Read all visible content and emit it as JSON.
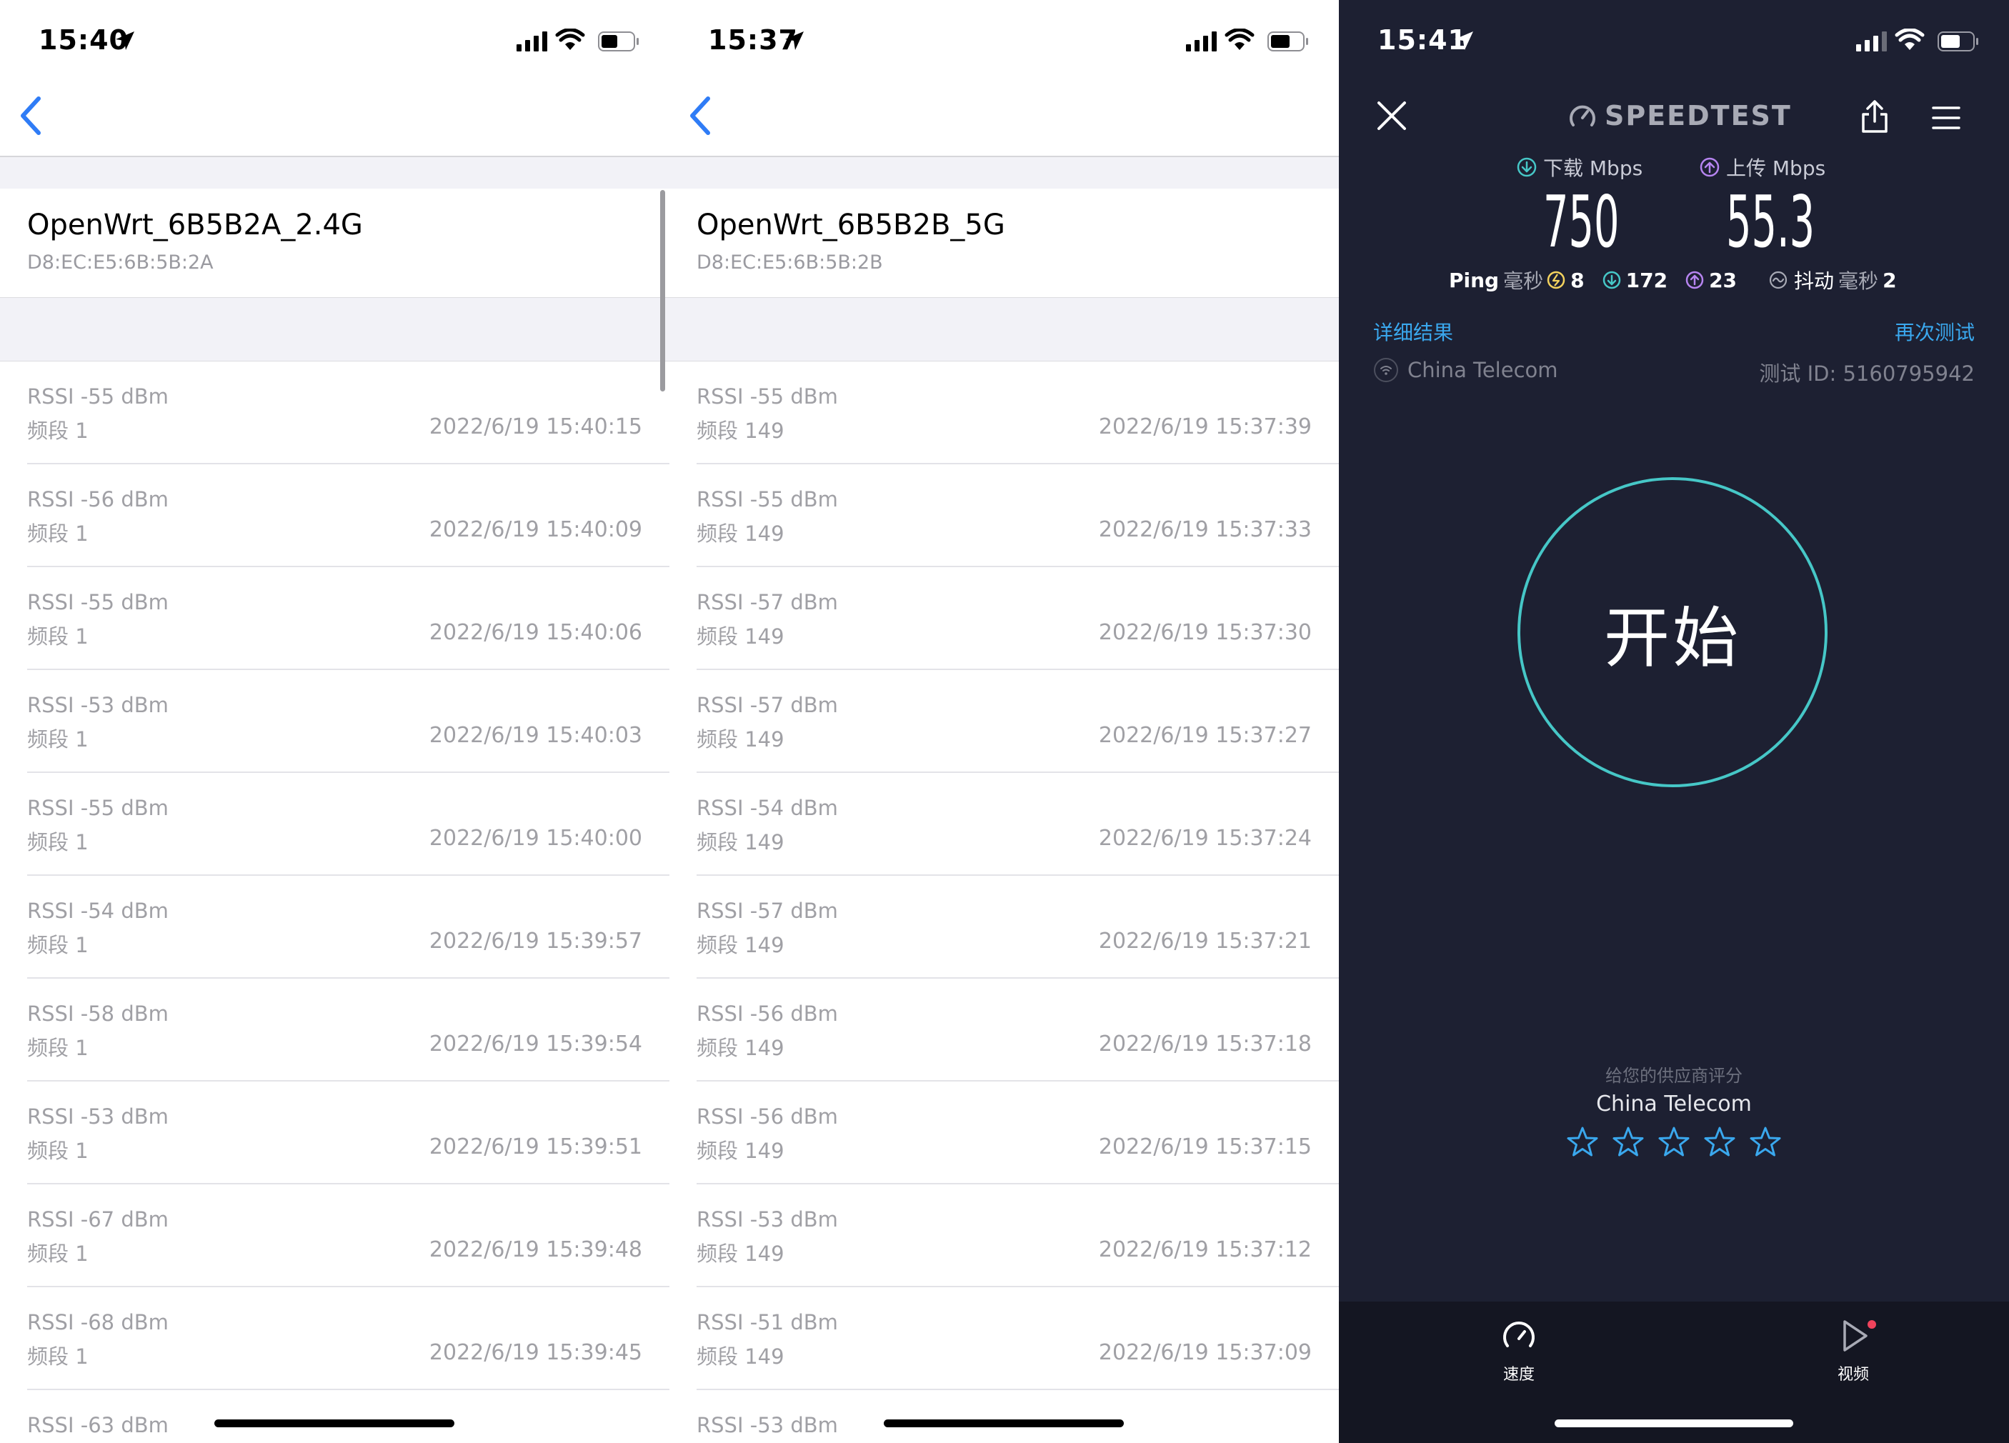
{
  "panel_24g": {
    "status_time": "15:40",
    "network_name": "OpenWrt_6B5B2A_2.4G",
    "mac": "D8:EC:E5:6B:5B:2A",
    "rows": [
      {
        "rssi": "RSSI -55 dBm",
        "band": "频段 1",
        "time": "2022/6/19 15:40:15"
      },
      {
        "rssi": "RSSI -56 dBm",
        "band": "频段 1",
        "time": "2022/6/19 15:40:09"
      },
      {
        "rssi": "RSSI -55 dBm",
        "band": "频段 1",
        "time": "2022/6/19 15:40:06"
      },
      {
        "rssi": "RSSI -53 dBm",
        "band": "频段 1",
        "time": "2022/6/19 15:40:03"
      },
      {
        "rssi": "RSSI -55 dBm",
        "band": "频段 1",
        "time": "2022/6/19 15:40:00"
      },
      {
        "rssi": "RSSI -54 dBm",
        "band": "频段 1",
        "time": "2022/6/19 15:39:57"
      },
      {
        "rssi": "RSSI -58 dBm",
        "band": "频段 1",
        "time": "2022/6/19 15:39:54"
      },
      {
        "rssi": "RSSI -53 dBm",
        "band": "频段 1",
        "time": "2022/6/19 15:39:51"
      },
      {
        "rssi": "RSSI -67 dBm",
        "band": "频段 1",
        "time": "2022/6/19 15:39:48"
      },
      {
        "rssi": "RSSI -68 dBm",
        "band": "频段 1",
        "time": "2022/6/19 15:39:45"
      },
      {
        "rssi": "RSSI -63 dBm",
        "band": "",
        "time": ""
      }
    ]
  },
  "panel_5g": {
    "status_time": "15:37",
    "network_name": "OpenWrt_6B5B2B_5G",
    "mac": "D8:EC:E5:6B:5B:2B",
    "rows": [
      {
        "rssi": "RSSI -55 dBm",
        "band": "频段 149",
        "time": "2022/6/19 15:37:39"
      },
      {
        "rssi": "RSSI -55 dBm",
        "band": "频段 149",
        "time": "2022/6/19 15:37:33"
      },
      {
        "rssi": "RSSI -57 dBm",
        "band": "频段 149",
        "time": "2022/6/19 15:37:30"
      },
      {
        "rssi": "RSSI -57 dBm",
        "band": "频段 149",
        "time": "2022/6/19 15:37:27"
      },
      {
        "rssi": "RSSI -54 dBm",
        "band": "频段 149",
        "time": "2022/6/19 15:37:24"
      },
      {
        "rssi": "RSSI -57 dBm",
        "band": "频段 149",
        "time": "2022/6/19 15:37:21"
      },
      {
        "rssi": "RSSI -56 dBm",
        "band": "频段 149",
        "time": "2022/6/19 15:37:18"
      },
      {
        "rssi": "RSSI -56 dBm",
        "band": "频段 149",
        "time": "2022/6/19 15:37:15"
      },
      {
        "rssi": "RSSI -53 dBm",
        "band": "频段 149",
        "time": "2022/6/19 15:37:12"
      },
      {
        "rssi": "RSSI -51 dBm",
        "band": "频段 149",
        "time": "2022/6/19 15:37:09"
      },
      {
        "rssi": "RSSI -53 dBm",
        "band": "",
        "time": ""
      }
    ]
  },
  "speedtest": {
    "status_time": "15:41",
    "logo": "SPEEDTEST",
    "download_label": "下载 Mbps",
    "upload_label": "上传 Mbps",
    "download_value": "750",
    "upload_value": "55.3",
    "ping_label": "Ping",
    "ms_label": "毫秒",
    "ping_idle": "8",
    "ping_download": "172",
    "ping_upload": "23",
    "jitter_label": "抖动",
    "jitter_value": "2",
    "details_link": "详细结果",
    "retest_link": "再次测试",
    "isp": "China Telecom",
    "test_id": "测试 ID: 5160795942",
    "go_label": "开始",
    "rate_prompt": "给您的供应商评分",
    "rate_isp": "China Telecom",
    "star_count": 5,
    "tab_speed": "速度",
    "tab_video": "视频",
    "colors": {
      "bg": "#1d2032",
      "accent_ring": "#46c7c7",
      "link": "#3aa8ee",
      "download": "#46c7c7",
      "upload": "#b684f0",
      "idle": "#f4d35e",
      "badge": "#f0435c"
    }
  }
}
